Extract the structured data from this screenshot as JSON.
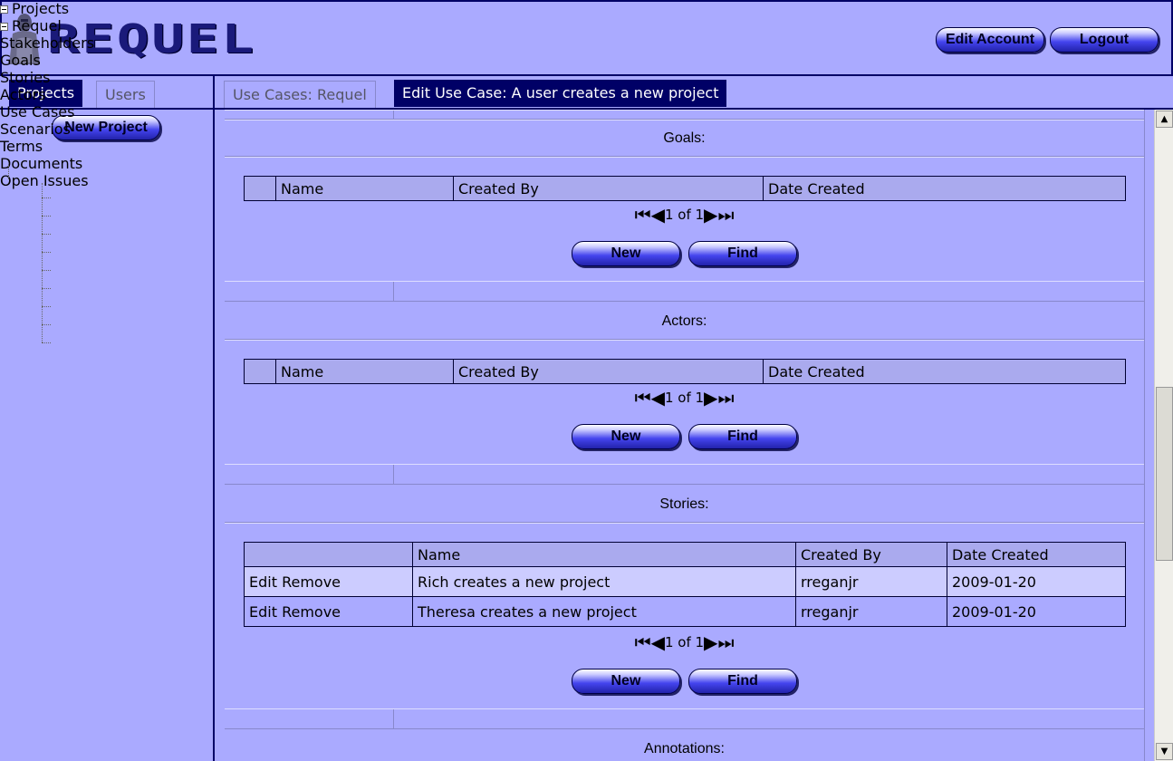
{
  "header": {
    "logo_text": "REQUEL",
    "edit_account_label": "Edit Account",
    "logout_label": "Logout"
  },
  "left_panel": {
    "tabs": [
      {
        "label": "Projects"
      },
      {
        "label": "Users"
      }
    ],
    "new_project_label": "New Project",
    "tree": {
      "root": "Projects",
      "project": "Requel",
      "items": [
        "Stakeholders",
        "Goals",
        "Stories",
        "Actors",
        "Use Cases",
        "Scenarios",
        "Terms",
        "Documents",
        "Open Issues"
      ]
    }
  },
  "main": {
    "tabs": [
      {
        "label": "Use Cases: Requel"
      },
      {
        "label": "Edit Use Case: A user creates a new project"
      }
    ],
    "sections": {
      "goals": {
        "title": "Goals:",
        "columns": [
          "",
          "Name",
          "Created By",
          "Date Created"
        ],
        "pager": "1 of 1",
        "new_label": "New",
        "find_label": "Find"
      },
      "actors": {
        "title": "Actors:",
        "columns": [
          "",
          "Name",
          "Created By",
          "Date Created"
        ],
        "pager": "1 of 1",
        "new_label": "New",
        "find_label": "Find"
      },
      "stories": {
        "title": "Stories:",
        "columns": [
          "",
          "Name",
          "Created By",
          "Date Created"
        ],
        "rows": [
          {
            "edit": "Edit",
            "remove": "Remove",
            "name": "Rich creates a new project",
            "created_by": "rreganjr",
            "date": "2009-01-20"
          },
          {
            "edit": "Edit",
            "remove": "Remove",
            "name": "Theresa creates a new project",
            "created_by": "rreganjr",
            "date": "2009-01-20"
          }
        ],
        "pager": "1 of 1",
        "new_label": "New",
        "find_label": "Find"
      },
      "annotations": {
        "title": "Annotations:"
      }
    }
  },
  "colors": {
    "background": "#aaaaff",
    "navy": "#000066",
    "header_row": "#aaaaee",
    "alt_row": "#ccccff"
  }
}
